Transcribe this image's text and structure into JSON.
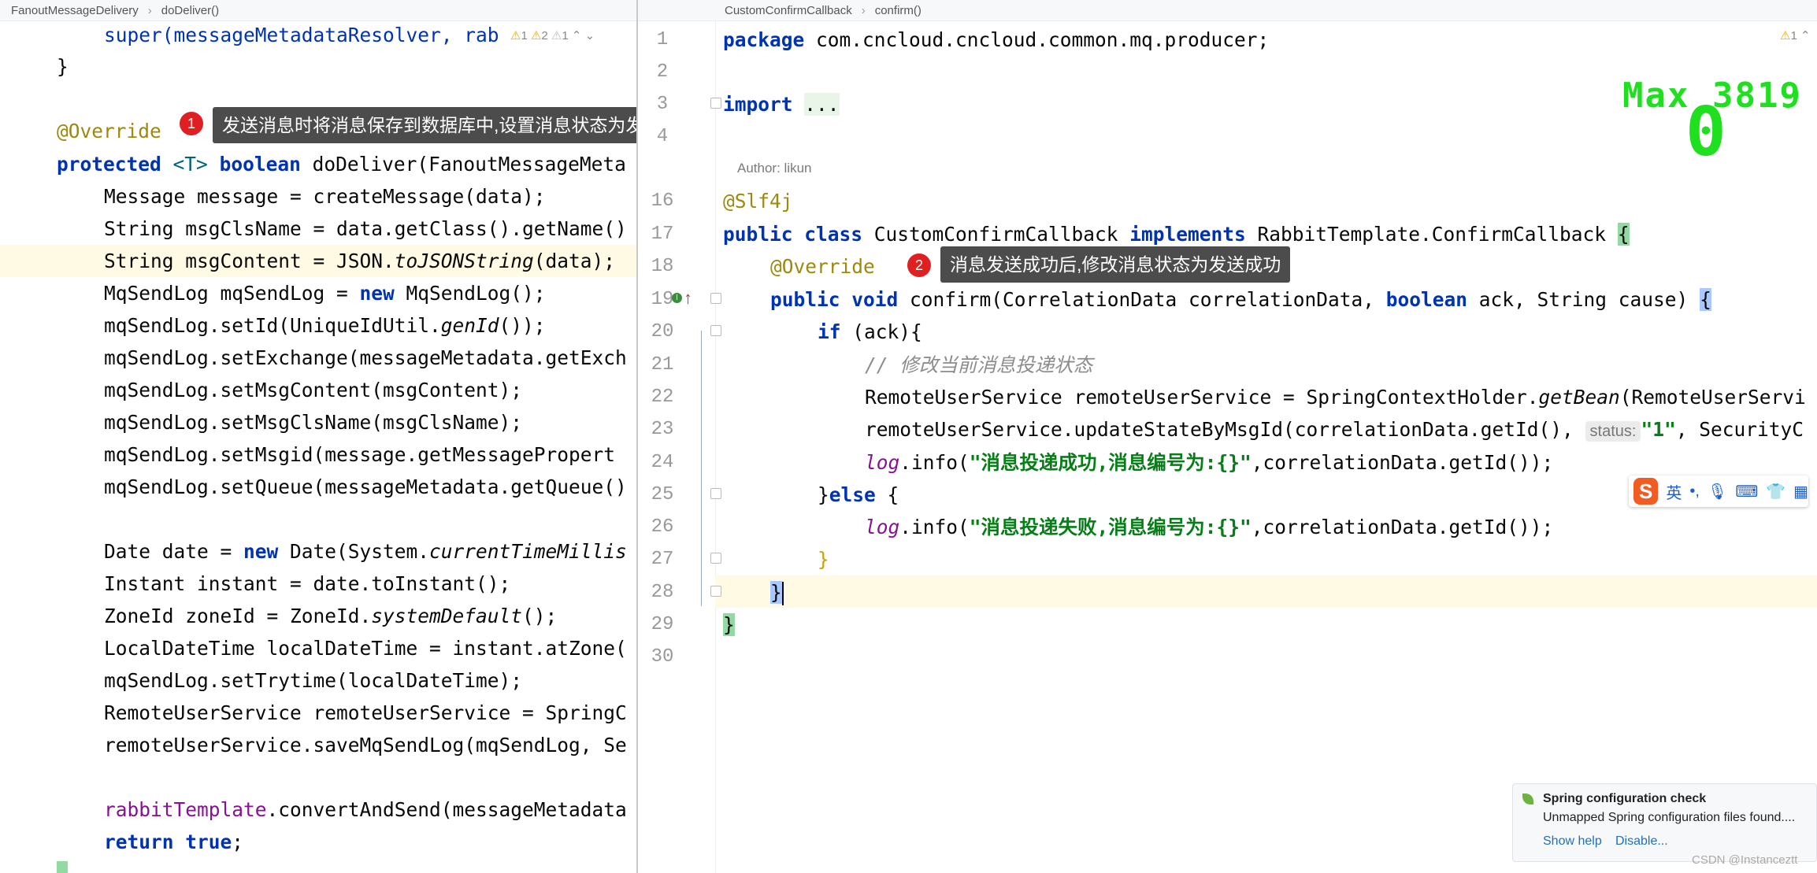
{
  "left_editor": {
    "breadcrumb": [
      "FanoutMessageDelivery",
      "doDeliver()"
    ],
    "warnings": {
      "w1": "1",
      "w2": "2",
      "w3": "1"
    },
    "tooltip_badge": "1",
    "tooltip_text": "发送消息时将消息保存到数据库中,设置消息状态为发送中",
    "lines": {
      "l0": "super(messageMetadataResolver, rab",
      "l1": "}",
      "l3": "@Override",
      "l4_a": "protected",
      "l4_b": "<T>",
      "l4_c": "boolean",
      "l4_d": "doDeliver(FanoutMessageMeta",
      "l5": "Message message = createMessage(data);",
      "l6": "String msgClsName = data.getClass().getName()",
      "l7_a": "String msgContent = JSON.",
      "l7_b": "toJSONString",
      "l7_c": "(data);",
      "l8_a": "MqSendLog mqSendLog = ",
      "l8_b": "new",
      "l8_c": " MqSendLog();",
      "l9_a": "mqSendLog.setId(UniqueIdUtil.",
      "l9_b": "genId",
      "l9_c": "());",
      "l10": "mqSendLog.setExchange(messageMetadata.getExch",
      "l11": "mqSendLog.setMsgContent(msgContent);",
      "l12": "mqSendLog.setMsgClsName(msgClsName);",
      "l13": "mqSendLog.setMsgid(message.getMessagePropert",
      "l14": "mqSendLog.setQueue(messageMetadata.getQueue()",
      "l16_a": "Date date = ",
      "l16_b": "new",
      "l16_c": " Date(System.",
      "l16_d": "currentTimeMillis",
      "l17": "Instant instant = date.toInstant();",
      "l18_a": "ZoneId zoneId = ZoneId.",
      "l18_b": "systemDefault",
      "l18_c": "();",
      "l19": "LocalDateTime localDateTime = instant.atZone(",
      "l20": "mqSendLog.setTrytime(localDateTime);",
      "l21": "RemoteUserService remoteUserService = SpringC",
      "l22": "remoteUserService.saveMqSendLog(mqSendLog, Se",
      "l24_a": "rabbitTemplate",
      "l24_b": ".convertAndSend(messageMetadata",
      "l25_a": "return",
      "l25_b": "true",
      "l25_c": ";"
    }
  },
  "right_editor": {
    "breadcrumb": [
      "CustomConfirmCallback",
      "confirm()"
    ],
    "warnings": {
      "w1": "1"
    },
    "line_numbers": [
      "1",
      "2",
      "3",
      "4",
      "16",
      "17",
      "18",
      "19",
      "20",
      "21",
      "22",
      "23",
      "24",
      "25",
      "26",
      "27",
      "28",
      "29",
      "30"
    ],
    "author_label": "Author: likun",
    "tooltip_badge": "2",
    "tooltip_text": "消息发送成功后,修改消息状态为发送成功",
    "inlay_hint": "status:",
    "lines": {
      "package_kw": "package",
      "package_name": " com.cncloud.cncloud.common.mq.producer;",
      "import_kw": "import",
      "import_dots": "...",
      "slf4j": "@Slf4j",
      "class_a": "public class",
      "class_b": " CustomConfirmCallback ",
      "class_c": "implements",
      "class_d": " RabbitTemplate.ConfirmCallback ",
      "brace_open": "{",
      "override": "@Override",
      "method_a": "public void",
      "method_b": " confirm(CorrelationData correlationData, ",
      "method_c": "boolean",
      "method_d": " ack, String cause) ",
      "if_a": "if",
      "if_b": " (ack){",
      "comment": "// 修改当前消息投递状态",
      "rus_a": "RemoteUserService remoteUserService = SpringContextHolder.",
      "rus_b": "getBean",
      "rus_c": "(RemoteUserServi",
      "upd_a": "remoteUserService.updateStateByMsgId(correlationData.getId(), ",
      "upd_b": "\"1\"",
      "upd_c": ", SecurityC",
      "log1_a": "log",
      "log1_b": ".info(",
      "log1_c": "\"消息投递成功,消息编号为:{}\"",
      "log1_d": ",correlationData.getId());",
      "else_a": "}",
      "else_b": "else",
      "else_c": " {",
      "log2_a": "log",
      "log2_b": ".info(",
      "log2_c": "\"消息投递失败,消息编号为:{}\"",
      "log2_d": ",correlationData.getId());",
      "close1": "}",
      "close2": "}",
      "close3": "}"
    }
  },
  "overlay": {
    "max_label": "Max 3819",
    "score": "0"
  },
  "ime_toolbar": {
    "logo": "S",
    "lang": "英",
    "punct": "•,",
    "icons": [
      "microphone-icon",
      "keyboard-icon",
      "shirt-icon",
      "grid-icon"
    ]
  },
  "notification": {
    "title": "Spring configuration check",
    "body": "Unmapped Spring configuration files found....",
    "link1": "Show help",
    "link2": "Disable..."
  },
  "watermark": "CSDN @Instanceztt",
  "colors": {
    "keyword": "#0033b3",
    "annotation": "#9e880d",
    "string": "#067d17",
    "tooltip_bg": "#4c4c4c",
    "badge": "#e02020",
    "overlay_green": "#1fe01f"
  }
}
